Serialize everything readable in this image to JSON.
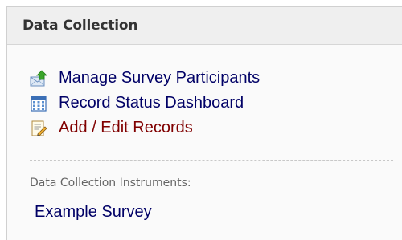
{
  "panel": {
    "title": "Data Collection",
    "links": [
      {
        "label": "Manage Survey Participants",
        "icon": "envelope-upload-icon"
      },
      {
        "label": "Record Status Dashboard",
        "icon": "table-grid-icon"
      },
      {
        "label": "Add / Edit Records",
        "icon": "document-pencil-icon"
      }
    ],
    "instruments_label": "Data Collection Instruments:",
    "instruments": [
      {
        "label": "Example Survey"
      }
    ]
  },
  "colors": {
    "link": "#000066",
    "link_red": "#800000",
    "header_bg": "#efefef",
    "label_gray": "#666666"
  }
}
